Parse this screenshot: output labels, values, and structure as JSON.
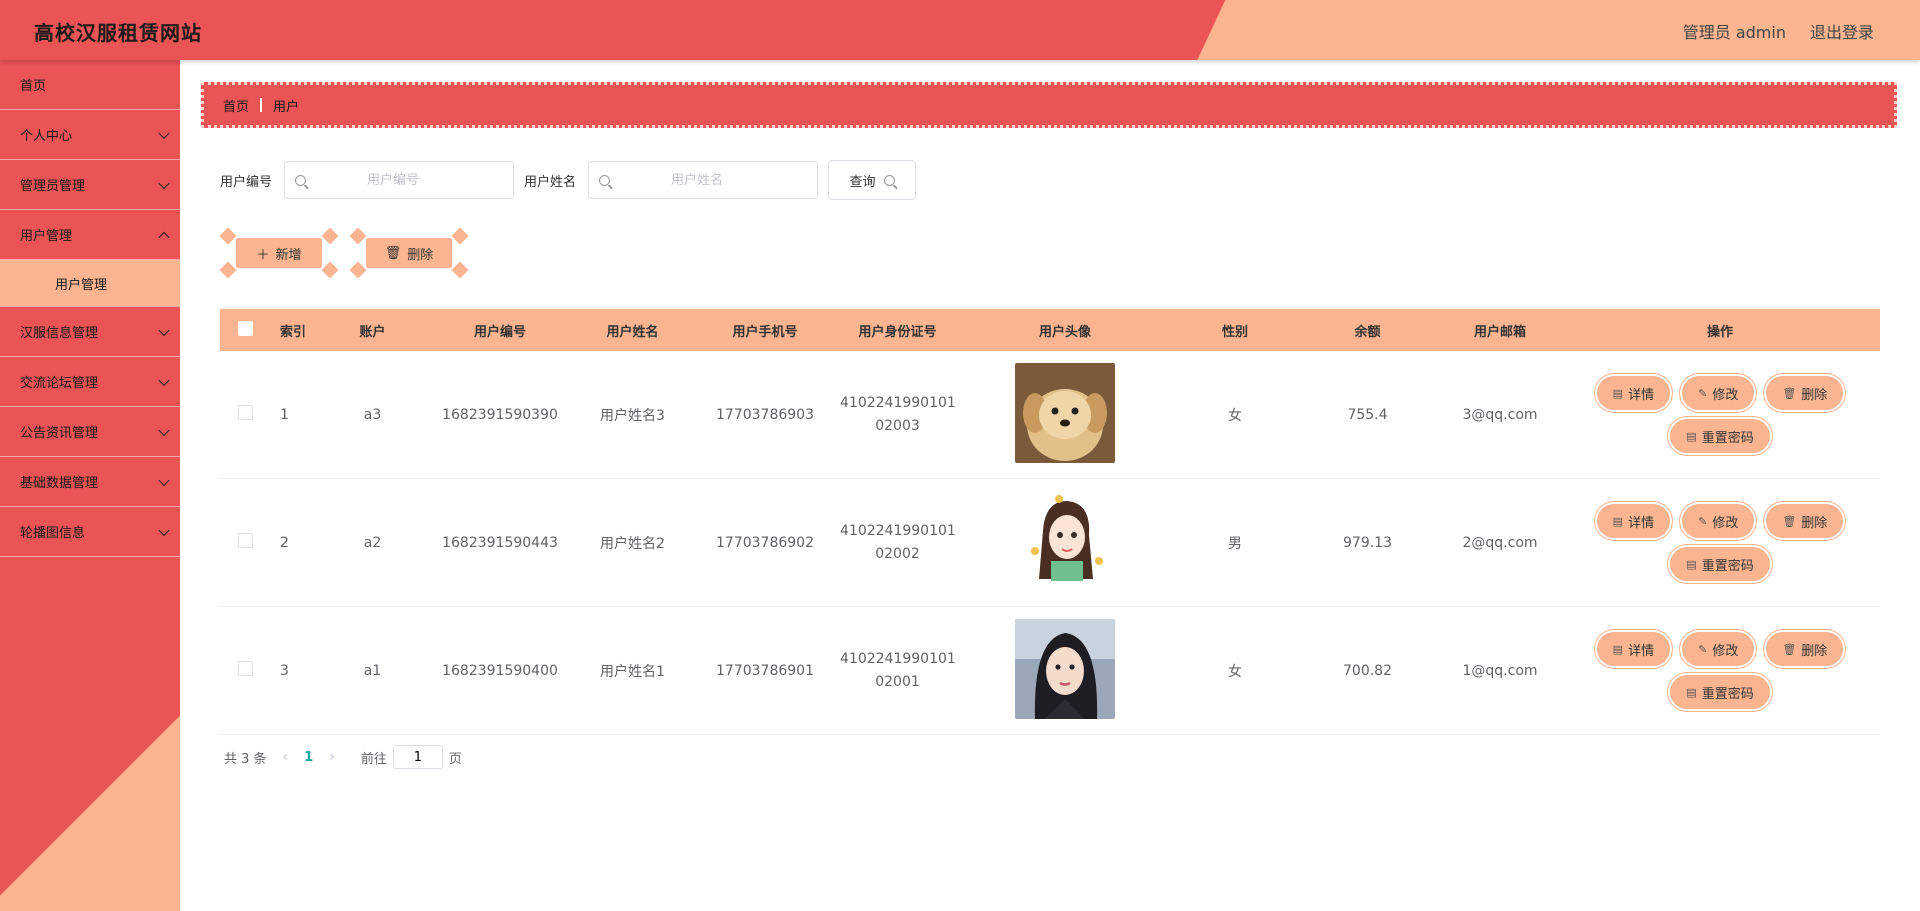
{
  "header": {
    "title": "高校汉服租赁网站",
    "user_label": "管理员 admin",
    "logout_label": "退出登录"
  },
  "sidebar": {
    "items": [
      {
        "label": "首页",
        "has_children": false
      },
      {
        "label": "个人中心",
        "has_children": true
      },
      {
        "label": "管理员管理",
        "has_children": true
      },
      {
        "label": "用户管理",
        "has_children": true,
        "open": true
      },
      {
        "label": "汉服信息管理",
        "has_children": true
      },
      {
        "label": "交流论坛管理",
        "has_children": true
      },
      {
        "label": "公告资讯管理",
        "has_children": true
      },
      {
        "label": "基础数据管理",
        "has_children": true
      },
      {
        "label": "轮播图信息",
        "has_children": true
      }
    ],
    "sub_item": "用户管理"
  },
  "breadcrumb": [
    "首页",
    "用户"
  ],
  "search": {
    "fields": [
      {
        "label": "用户编号",
        "placeholder": "用户编号"
      },
      {
        "label": "用户姓名",
        "placeholder": "用户姓名"
      }
    ],
    "query_label": "查询"
  },
  "actions": {
    "add_label": "新增",
    "delete_label": "删除"
  },
  "table": {
    "columns": [
      "索引",
      "账户",
      "用户编号",
      "用户姓名",
      "用户手机号",
      "用户身份证号",
      "用户头像",
      "性别",
      "余额",
      "用户邮箱",
      "操作"
    ],
    "rows": [
      {
        "index": "1",
        "account": "a3",
        "user_no": "1682391590390",
        "name": "用户姓名3",
        "phone": "17703786903",
        "id_line1": "4102241990101",
        "id_line2": "02003",
        "avatar": "puppy",
        "gender": "女",
        "balance": "755.4",
        "email": "3@qq.com"
      },
      {
        "index": "2",
        "account": "a2",
        "user_no": "1682391590443",
        "name": "用户姓名2",
        "phone": "17703786902",
        "id_line1": "4102241990101",
        "id_line2": "02002",
        "avatar": "cartoon-girl",
        "gender": "男",
        "balance": "979.13",
        "email": "2@qq.com"
      },
      {
        "index": "3",
        "account": "a1",
        "user_no": "1682391590400",
        "name": "用户姓名1",
        "phone": "17703786901",
        "id_line1": "4102241990101",
        "id_line2": "02001",
        "avatar": "portrait-girl",
        "gender": "女",
        "balance": "700.82",
        "email": "1@qq.com"
      }
    ],
    "ops": {
      "detail": "详情",
      "edit": "修改",
      "delete": "删除",
      "reset": "重置密码"
    }
  },
  "pagination": {
    "total": "共 3 条",
    "current": "1",
    "goto_prefix": "前往",
    "goto_value": "1",
    "goto_suffix": "页"
  },
  "colors": {
    "primary": "#ea5455",
    "accent": "#fdb591",
    "page_active": "#11a6a0"
  }
}
